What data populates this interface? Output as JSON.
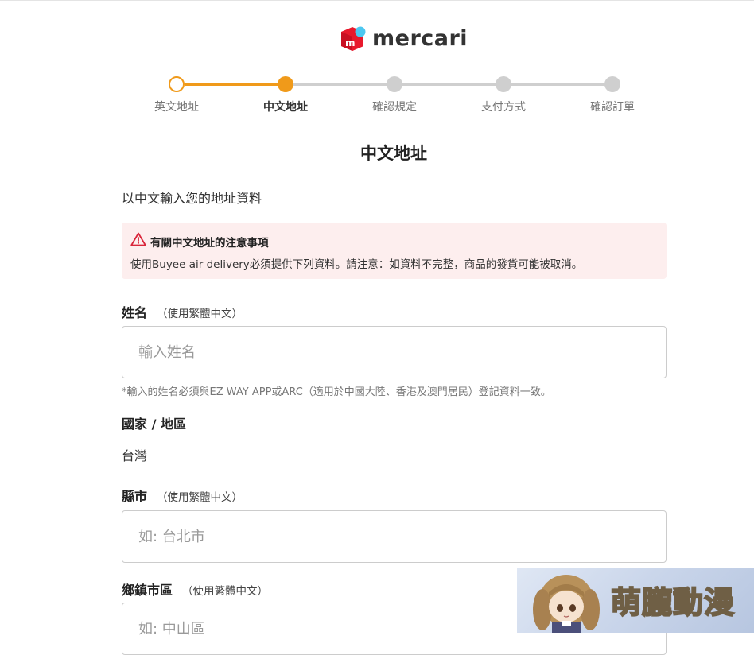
{
  "app": {
    "brand": "mercari",
    "accent_color": "#f09a1a",
    "logo_color": "#e8192c"
  },
  "stepper": {
    "steps": [
      {
        "label": "英文地址",
        "state": "done"
      },
      {
        "label": "中文地址",
        "state": "current"
      },
      {
        "label": "確認規定",
        "state": "todo"
      },
      {
        "label": "支付方式",
        "state": "todo"
      },
      {
        "label": "確認訂單",
        "state": "todo"
      }
    ]
  },
  "page": {
    "title": "中文地址",
    "subtitle": "以中文輸入您的地址資料"
  },
  "notice": {
    "icon": "warning-icon",
    "title": "有關中文地址的注意事項",
    "body": "使用Buyee air delivery必須提供下列資料。請注意：如資料不完整，商品的發貨可能被取消。"
  },
  "form": {
    "name": {
      "label": "姓名",
      "hint": "（使用繁體中文）",
      "placeholder": "輸入姓名",
      "value": "",
      "helper": "*輸入的姓名必須與EZ WAY APP或ARC（適用於中國大陸、香港及澳門居民）登記資料一致。"
    },
    "country": {
      "label": "國家 / 地區",
      "value": "台灣"
    },
    "city": {
      "label": "縣市",
      "hint": "（使用繁體中文）",
      "placeholder": "如: 台北市",
      "value": ""
    },
    "district": {
      "label": "鄉鎮市區",
      "hint": "（使用繁體中文）",
      "placeholder": "如: 中山區",
      "value": ""
    }
  },
  "watermark": {
    "text": "萌朧動漫"
  }
}
